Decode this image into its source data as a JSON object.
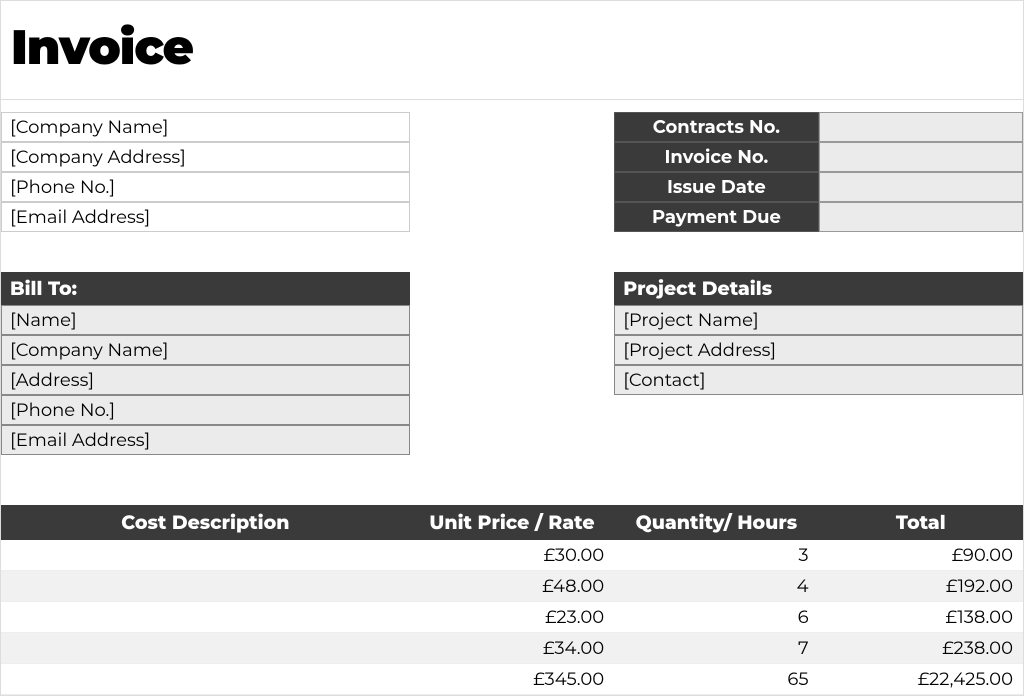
{
  "title": "Invoice",
  "company": {
    "name": "[Company Name]",
    "address": "[Company Address]",
    "phone": "[Phone No.]",
    "email": "[Email Address]"
  },
  "meta_labels": {
    "contracts_no": "Contracts No.",
    "invoice_no": "Invoice No.",
    "issue_date": "Issue Date",
    "payment_due": "Payment Due"
  },
  "meta_values": {
    "contracts_no": "",
    "invoice_no": "",
    "issue_date": "",
    "payment_due": ""
  },
  "bill_to": {
    "header": "Bill To:",
    "name": "[Name]",
    "company": "[Company Name]",
    "address": "[Address]",
    "phone": "[Phone No.]",
    "email": "[Email Address]"
  },
  "project": {
    "header": "Project Details",
    "name": "[Project Name]",
    "address": "[Project Address]",
    "contact": "[Contact]"
  },
  "columns": {
    "desc": "Cost Description",
    "unit": "Unit Price / Rate",
    "qty": "Quantity/ Hours",
    "total": "Total"
  },
  "items": [
    {
      "desc": "",
      "unit": "£30.00",
      "qty": "3",
      "total": "£90.00"
    },
    {
      "desc": "",
      "unit": "£48.00",
      "qty": "4",
      "total": "£192.00"
    },
    {
      "desc": "",
      "unit": "£23.00",
      "qty": "6",
      "total": "£138.00"
    },
    {
      "desc": "",
      "unit": "£34.00",
      "qty": "7",
      "total": "£238.00"
    },
    {
      "desc": "",
      "unit": "£345.00",
      "qty": "65",
      "total": "£22,425.00"
    }
  ]
}
